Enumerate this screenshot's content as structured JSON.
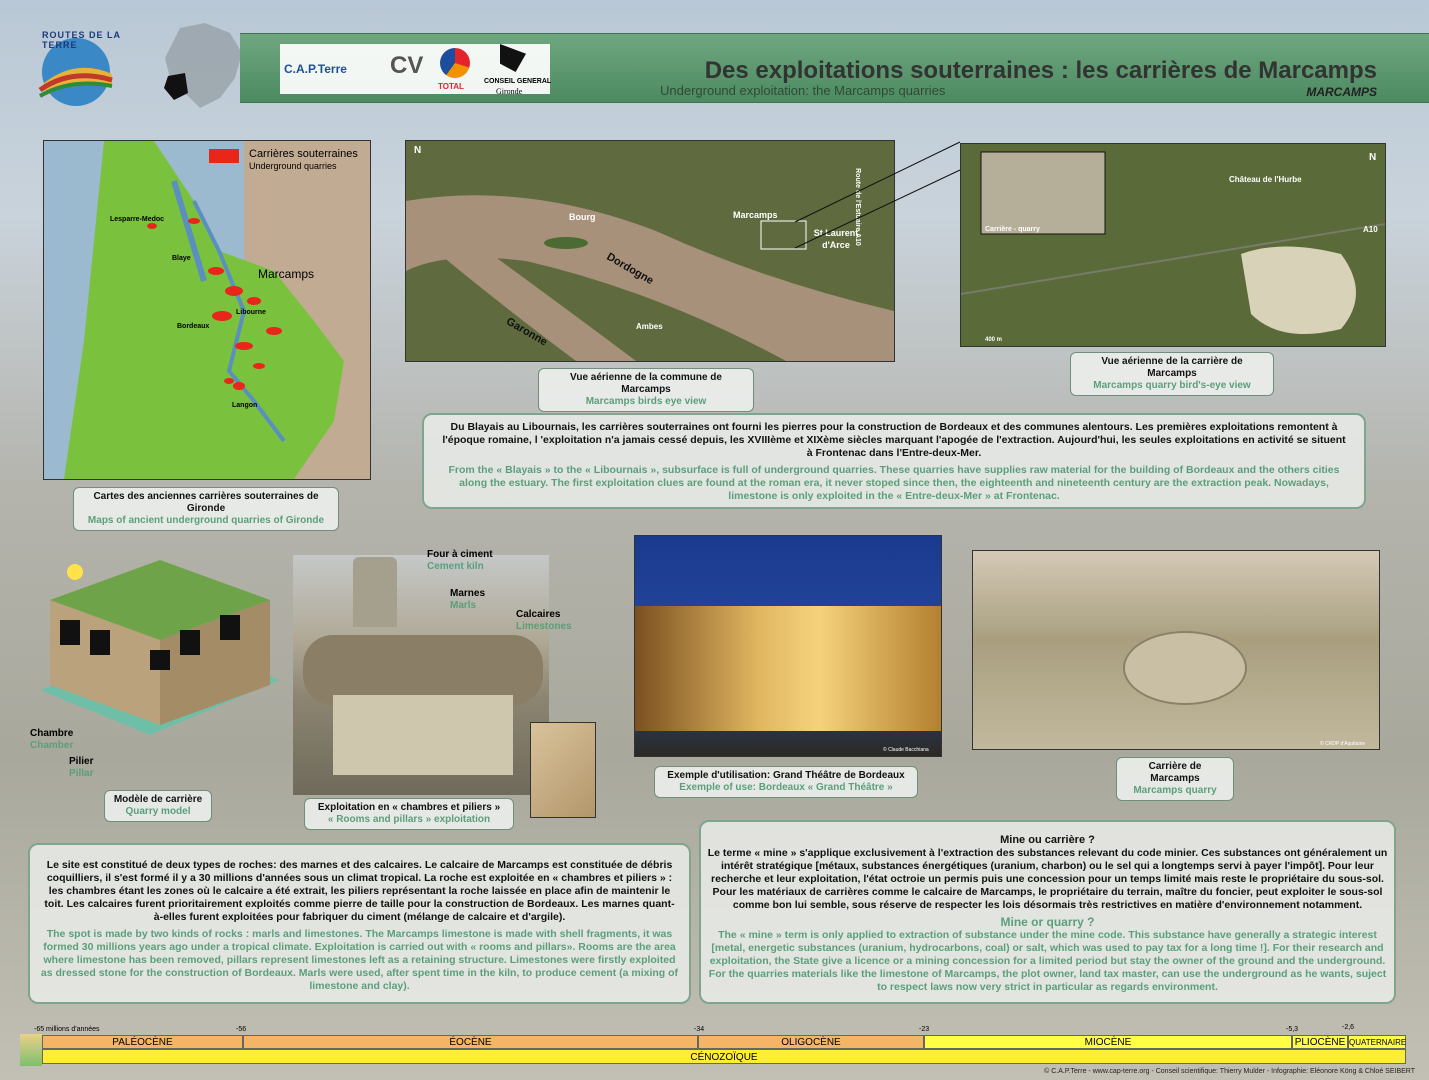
{
  "header": {
    "title": "Des exploitations souterraines : les carrières de Marcamps",
    "subtitle": "Underground exploitation: the Marcamps quarries",
    "place": "MARCAMPS",
    "logo_text": "ROUTES DE LA TERRE",
    "partners": [
      "C.A.P.Terre",
      "CV",
      "TOTAL",
      "CONSEIL GENERAL",
      "Gironde"
    ]
  },
  "map_gironde": {
    "legend_fr": "Carrières souterraines",
    "legend_en": "Underground quarries",
    "places": [
      "Lesparre-Medoc",
      "Blaye",
      "Marcamps",
      "Libourne",
      "Bordeaux",
      "Langon"
    ],
    "caption_fr": "Cartes des anciennes carrières souterraines de Gironde",
    "caption_en": "Maps of ancient underground quarries of Gironde"
  },
  "aerial_commune": {
    "labels": [
      "N",
      "Bourg",
      "Marcamps",
      "St Laurent d'Arce",
      "Dordogne",
      "Garonne",
      "Ambes",
      "Route de l'Estuaire A10"
    ],
    "caption_fr": "Vue aérienne de la commune de Marcamps",
    "caption_en": "Marcamps birds eye view"
  },
  "aerial_quarry": {
    "labels": [
      "N",
      "Château de l'Hurbe",
      "Carrière - quarry",
      "A10",
      "400 m"
    ],
    "caption_fr": "Vue aérienne de la carrière de Marcamps",
    "caption_en": "Marcamps quarry bird's-eye view"
  },
  "intro": {
    "fr": "Du Blayais au Libournais, les carrières souterraines ont fourni les pierres pour la construction de Bordeaux et des communes alentours. Les premières exploitations remontent à l'époque romaine, l 'exploitation n'a jamais cessé depuis, les XVIIIème et XIXème siècles marquant l'apogée de l'extraction. Aujourd'hui, les seules exploitations en activité se situent à Frontenac dans l'Entre-deux-Mer.",
    "en": "From the « Blayais » to the « Libournais », subsurface is full of underground quarries. These quarries have supplies raw material for the building of Bordeaux and the others cities along the estuary. The first exploitation clues are found at the roman era, it never stoped since then, the eighteenth and nineteenth century are the extraction peak. Nowadays, limestone is only exploited in the « Entre-deux-Mer » at Frontenac."
  },
  "quarry_model": {
    "chambre_fr": "Chambre",
    "chambre_en": "Chamber",
    "pilier_fr": "Pilier",
    "pilier_en": "Pillar",
    "caption_fr": "Modèle de carrière",
    "caption_en": "Quarry model"
  },
  "exploitation_photo": {
    "four_fr": "Four à ciment",
    "four_en": "Cement kiln",
    "marnes_fr": "Marnes",
    "marnes_en": "Marls",
    "calcaires_fr": "Calcaires",
    "calcaires_en": "Limestones",
    "caption_fr": "Exploitation en « chambres et piliers »",
    "caption_en": "« Rooms and pillars » exploitation"
  },
  "theatre_photo": {
    "credit": "© Claude Bacchiana",
    "caption_fr": "Exemple d'utilisation: Grand Théâtre de Bordeaux",
    "caption_en": "Exemple of use: Bordeaux « Grand Théâtre »"
  },
  "marcamps_photo": {
    "credit": "© CRDP d'Aquitaine",
    "caption_fr": "Carrière de Marcamps",
    "caption_en": "Marcamps quarry"
  },
  "rocks": {
    "fr": "Le site est constitué de deux types de roches: des marnes et des calcaires. Le calcaire de Marcamps est constituée de débris coquilliers, il s'est formé il y a 30 millions d'années sous un climat tropical. La roche est exploitée en « chambres et piliers » : les chambres étant les zones où le calcaire a été extrait, les piliers représentant la roche laissée en place afin de maintenir le toit. Les calcaires furent prioritairement exploités comme pierre de taille pour la construction de Bordeaux. Les marnes quant-à-elles furent exploitées pour fabriquer du ciment (mélange de calcaire et d'argile).",
    "en": "The spot is made by two kinds of rocks : marls and limestones. The Marcamps limestone is made with shell fragments, it was formed 30 millions years ago under a tropical climate. Exploitation is carried out with « rooms and pillars». Rooms are the area where limestone has been removed, pillars represent limestones left as a retaining structure. Limestones were firstly exploited as dressed stone for the construction of Bordeaux. Marls were used, after spent time in the kiln, to produce cement (a mixing of limestone and clay)."
  },
  "mine": {
    "title_fr": "Mine ou carrière ?",
    "fr": "Le terme « mine » s'applique exclusivement à l'extraction des substances relevant du code minier. Ces substances ont généralement un intérêt stratégique [métaux, substances énergétiques (uranium, charbon) ou le sel qui a longtemps servi à payer l'impôt]. Pour leur recherche et leur exploitation, l'état octroie un permis puis une concession pour un temps limité mais reste le propriétaire du sous-sol. Pour les matériaux de carrières comme le calcaire de Marcamps, le propriétaire du terrain, maître du foncier, peut exploiter le sous-sol comme bon lui semble, sous réserve de respecter les lois désormais très restrictives en matière d'environnement notamment.",
    "title_en": "Mine or quarry ?",
    "en": "The « mine » term is only applied to extraction of substance under the mine code. This substance have generally a strategic interest [metal, energetic substances (uranium, hydrocarbons, coal) or salt, which was used to pay tax for a long time !]. For their research and exploitation, the State give a licence or a mining  concession for a limited period but stay the owner of the ground and the underground. For the quarries materials like the limestone of Marcamps, the plot owner,  land tax master, can use the underground as he wants, suject to respect laws now very strict in particular as regards environment."
  },
  "timeline": {
    "ticks": [
      "-65 millions d'années",
      "-56",
      "-34",
      "-23",
      "-5,3",
      "-2,6"
    ],
    "epochs": [
      "PALÉOCÈNE",
      "ÉOCÈNE",
      "OLIGOCÈNE",
      "MIOCÈNE",
      "PLIOCÈNE",
      "QUATERNAIRE"
    ],
    "era": "CÉNOZOÏQUE",
    "colors": {
      "paleogene": "#f5b567",
      "neogene": "#ffff44",
      "era": "#ffee33"
    }
  },
  "footer": "© C.A.P.Terre - www.cap-terre.org - Conseil scientifique: Thierry Mulder - Infographie: Eléonore Köng & Chloé SEIBERT"
}
